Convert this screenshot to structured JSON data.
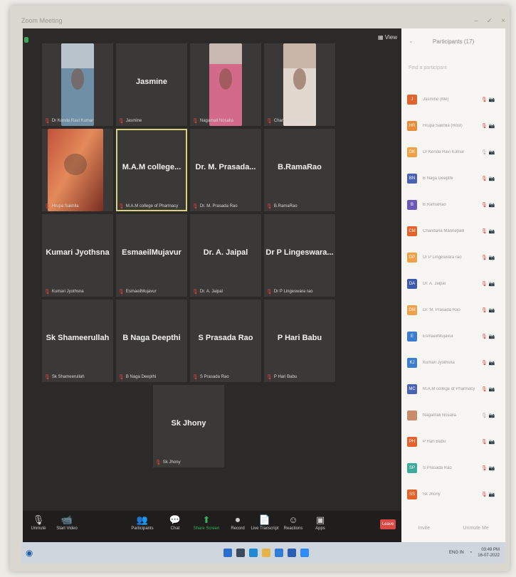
{
  "window": {
    "title": "Zoom Meeting",
    "controls": [
      "–",
      "✓",
      "×"
    ]
  },
  "view_button": "View",
  "tiles": [
    {
      "name": "",
      "tag": "Dr Konda Ravi Kumar",
      "video": "c1"
    },
    {
      "name": "Jasmine",
      "tag": "Jasmine",
      "video": ""
    },
    {
      "name": "",
      "tag": "Nagamali Nosalia",
      "video": "c2"
    },
    {
      "name": "",
      "tag": "Chandana Mannepalli",
      "video": "c3"
    },
    {
      "name": "",
      "tag": "Hrupa Sakhila",
      "video": "c4"
    },
    {
      "name": "M.A.M college...",
      "tag": "M.A.M college of Pharmacy",
      "video": "",
      "active": true
    },
    {
      "name": "Dr. M. Prasada...",
      "tag": "Dr. M. Prasada Rao",
      "video": ""
    },
    {
      "name": "B.RamaRao",
      "tag": "B.RamaRao",
      "video": ""
    },
    {
      "name": "Kumari Jyothsna",
      "tag": "Kumari Jyothsna",
      "video": ""
    },
    {
      "name": "EsmaeilMujavur",
      "tag": "EsmaeilMujavur",
      "video": ""
    },
    {
      "name": "Dr. A. Jaipal",
      "tag": "Dr. A. Jaipal",
      "video": ""
    },
    {
      "name": "Dr P Lingeswara...",
      "tag": "Dr P Lingeswara rao",
      "video": ""
    },
    {
      "name": "Sk Shameerullah",
      "tag": "Sk Shameerullah",
      "video": ""
    },
    {
      "name": "B Naga Deepthi",
      "tag": "B Naga Deepthi",
      "video": ""
    },
    {
      "name": "S Prasada Rao",
      "tag": "S Prasada Rao",
      "video": ""
    },
    {
      "name": "P Hari Babu",
      "tag": "P Hari Babu",
      "video": ""
    },
    {
      "name": "Sk Jhony",
      "tag": "Sk Jhony",
      "video": ""
    }
  ],
  "toolbar": {
    "items": [
      {
        "label": "Unmute",
        "icon": "microphone-icon"
      },
      {
        "label": "Start Video",
        "icon": "video-icon"
      },
      {
        "label": "Participants",
        "icon": "participants-icon",
        "count": "17"
      },
      {
        "label": "Chat",
        "icon": "chat-icon"
      },
      {
        "label": "Share Screen",
        "icon": "share-screen-icon"
      },
      {
        "label": "Record",
        "icon": "record-icon"
      },
      {
        "label": "Live Transcript",
        "icon": "transcript-icon"
      },
      {
        "label": "Reactions",
        "icon": "reactions-icon"
      },
      {
        "label": "Apps",
        "icon": "apps-icon"
      }
    ],
    "leave_label": "Leave"
  },
  "participants_panel": {
    "title": "Participants (17)",
    "search_placeholder": "Find a participant",
    "rows": [
      {
        "initials": "J",
        "name": "Jasmine (Me)",
        "color": "#e0642c",
        "muted": true
      },
      {
        "initials": "HR",
        "name": "Hrupa Sakhila (Host)",
        "color": "#e88c3a",
        "muted": true
      },
      {
        "initials": "DK",
        "name": "Dr Konda Ravi Kumar",
        "color": "#f0a24a",
        "muted": false
      },
      {
        "initials": "BN",
        "name": "B Naga Deepthi",
        "color": "#4a63b0",
        "muted": true
      },
      {
        "initials": "B",
        "name": "B.RamaRao",
        "color": "#6b59b8",
        "muted": true
      },
      {
        "initials": "CM",
        "name": "Chandana Mannepalli",
        "color": "#e0642c",
        "muted": true
      },
      {
        "initials": "DP",
        "name": "Dr P Lingeswara rao",
        "color": "#f0a24a",
        "muted": true
      },
      {
        "initials": "DA",
        "name": "Dr. A. Jaipal",
        "color": "#3d5aa8",
        "muted": true
      },
      {
        "initials": "DM",
        "name": "Dr. M. Prasada Rao",
        "color": "#f0a24a",
        "muted": true
      },
      {
        "initials": "E",
        "name": "EsmaeilMujavur",
        "color": "#3d7dd0",
        "muted": true
      },
      {
        "initials": "KJ",
        "name": "Kumari Jyothsna",
        "color": "#3d7dd0",
        "muted": true
      },
      {
        "initials": "MC",
        "name": "M.A.M college of Pharmacy",
        "color": "#4a63b0",
        "muted": true
      },
      {
        "initials": "",
        "name": "Nagamali Nosalia",
        "color": "#c98a6a",
        "muted": false
      },
      {
        "initials": "PH",
        "name": "P Hari Babu",
        "color": "#e0642c",
        "muted": true
      },
      {
        "initials": "SP",
        "name": "S Prasada Rao",
        "color": "#3daa9a",
        "muted": true
      },
      {
        "initials": "SS",
        "name": "Sk Jhony",
        "color": "#e0642c",
        "muted": true
      }
    ],
    "footer": [
      "Invite",
      "Unmute Me"
    ]
  },
  "taskbar": {
    "start_icon": "windows-icon",
    "language": "ENG IN",
    "time": "03:49 PM",
    "date": "16-07-2022"
  },
  "colors": {
    "meeting_bg": "#2b2a28",
    "tile_bg": "#3a3937",
    "active_outline": "#d8d27a",
    "leave_red": "#d94a45",
    "share_green": "#33b35a"
  }
}
